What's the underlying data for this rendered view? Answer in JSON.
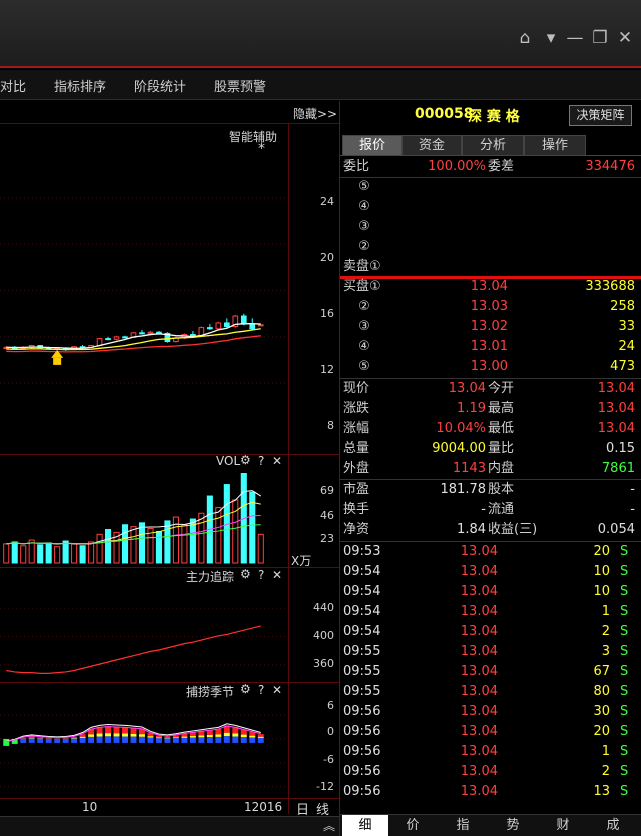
{
  "menu": [
    "对比",
    "指标排序",
    "阶段统计",
    "股票预警"
  ],
  "hide_label": "隐藏>>",
  "main_chart": {
    "title": "智能辅助",
    "star": "*",
    "y_ticks": [
      "24",
      "20",
      "16",
      "12",
      "8"
    ]
  },
  "vol_panel": {
    "title": "VOL",
    "y_ticks": [
      "69",
      "46",
      "23"
    ],
    "unit": "X万"
  },
  "zlzz_panel": {
    "title": "主力追踪",
    "y_ticks": [
      "440",
      "400",
      "360"
    ]
  },
  "bljj_panel": {
    "title": "捕捞季节",
    "y_ticks": [
      "6",
      "0",
      "-6",
      "-12"
    ]
  },
  "x_axis": {
    "labels": [
      "10",
      "12016"
    ],
    "period": "日",
    "line": "线"
  },
  "panel_icons": {
    "gear": "⚙",
    "help": "?",
    "close": "✕"
  },
  "stock": {
    "code": "000058",
    "name": "深 赛 格",
    "decision_btn": "决策矩阵"
  },
  "tabs": [
    "报价",
    "资金",
    "分析",
    "操作"
  ],
  "weibi": {
    "label": "委比",
    "value": "100.00%",
    "diff_label": "委差",
    "diff_value": "334476"
  },
  "sell_orders": [
    {
      "label": "⑤",
      "price": "",
      "vol": ""
    },
    {
      "label": "④",
      "price": "",
      "vol": ""
    },
    {
      "label": "③",
      "price": "",
      "vol": ""
    },
    {
      "label": "②",
      "price": "",
      "vol": ""
    },
    {
      "label": "卖盘①",
      "price": "",
      "vol": ""
    }
  ],
  "buy_orders": [
    {
      "label": "买盘①",
      "price": "13.04",
      "vol": "333688"
    },
    {
      "label": "②",
      "price": "13.03",
      "vol": "258"
    },
    {
      "label": "③",
      "price": "13.02",
      "vol": "33"
    },
    {
      "label": "④",
      "price": "13.01",
      "vol": "24"
    },
    {
      "label": "⑤",
      "price": "13.00",
      "vol": "473"
    }
  ],
  "stats1": [
    {
      "l1": "现价",
      "v1": "13.04",
      "l2": "今开",
      "v2": "13.04"
    },
    {
      "l1": "涨跌",
      "v1": "1.19",
      "l2": "最高",
      "v2": "13.04"
    },
    {
      "l1": "涨幅",
      "v1": "10.04%",
      "l2": "最低",
      "v2": "13.04"
    },
    {
      "l1": "总量",
      "v1": "9004.00",
      "l2": "量比",
      "v2": "0.15"
    },
    {
      "l1": "外盘",
      "v1": "1143",
      "l2": "内盘",
      "v2": "7861"
    }
  ],
  "stats2": [
    {
      "l1": "市盈",
      "v1": "181.78",
      "l2": "股本",
      "v2": "-"
    },
    {
      "l1": "换手",
      "v1": "-",
      "l2": "流通",
      "v2": "-"
    },
    {
      "l1": "净资",
      "v1": "1.84",
      "l2": "收益(三)",
      "v2": "0.054"
    }
  ],
  "ticks": [
    {
      "time": "09:53",
      "price": "13.04",
      "vol": "20",
      "flag": "S"
    },
    {
      "time": "09:54",
      "price": "13.04",
      "vol": "10",
      "flag": "S"
    },
    {
      "time": "09:54",
      "price": "13.04",
      "vol": "10",
      "flag": "S"
    },
    {
      "time": "09:54",
      "price": "13.04",
      "vol": "1",
      "flag": "S"
    },
    {
      "time": "09:54",
      "price": "13.04",
      "vol": "2",
      "flag": "S"
    },
    {
      "time": "09:55",
      "price": "13.04",
      "vol": "3",
      "flag": "S"
    },
    {
      "time": "09:55",
      "price": "13.04",
      "vol": "67",
      "flag": "S"
    },
    {
      "time": "09:55",
      "price": "13.04",
      "vol": "80",
      "flag": "S"
    },
    {
      "time": "09:56",
      "price": "13.04",
      "vol": "30",
      "flag": "S"
    },
    {
      "time": "09:56",
      "price": "13.04",
      "vol": "20",
      "flag": "S"
    },
    {
      "time": "09:56",
      "price": "13.04",
      "vol": "1",
      "flag": "S"
    },
    {
      "time": "09:56",
      "price": "13.04",
      "vol": "2",
      "flag": "S"
    },
    {
      "time": "09:56",
      "price": "13.04",
      "vol": "13",
      "flag": "S"
    }
  ],
  "bottom_tabs": [
    "细",
    "价",
    "指",
    "势",
    "财",
    "成"
  ],
  "colors": {
    "up": "#ff4040",
    "down": "#40ffff",
    "accent_red": "#e01010",
    "yellow": "#ffff30"
  },
  "chart_data": [
    {
      "type": "line",
      "panel": "智能辅助",
      "ylim": [
        8,
        24
      ],
      "candles": [
        [
          11.0,
          11.2,
          10.9,
          11.1
        ],
        [
          11.1,
          11.2,
          10.95,
          11.05
        ],
        [
          11.05,
          11.2,
          11.0,
          11.1
        ],
        [
          11.1,
          11.3,
          11.0,
          11.25
        ],
        [
          11.25,
          11.3,
          11.0,
          11.05
        ],
        [
          11.05,
          11.15,
          10.9,
          10.95
        ],
        [
          10.95,
          11.1,
          10.85,
          11.0
        ],
        [
          11.0,
          11.1,
          10.8,
          10.9
        ],
        [
          10.9,
          11.2,
          10.85,
          11.15
        ],
        [
          11.15,
          11.3,
          11.0,
          11.1
        ],
        [
          11.1,
          11.3,
          11.05,
          11.25
        ],
        [
          11.25,
          11.9,
          11.2,
          11.85
        ],
        [
          11.85,
          12.0,
          11.7,
          11.8
        ],
        [
          11.8,
          12.1,
          11.7,
          12.0
        ],
        [
          12.0,
          12.1,
          11.85,
          11.95
        ],
        [
          11.95,
          12.4,
          11.9,
          12.35
        ],
        [
          12.35,
          12.6,
          12.2,
          12.3
        ],
        [
          12.3,
          12.5,
          12.15,
          12.4
        ],
        [
          12.4,
          12.5,
          12.2,
          12.3
        ],
        [
          12.3,
          12.4,
          11.5,
          11.6
        ],
        [
          11.6,
          12.0,
          11.5,
          11.9
        ],
        [
          11.9,
          12.3,
          11.8,
          12.2
        ],
        [
          12.2,
          12.5,
          12.0,
          12.1
        ],
        [
          12.1,
          12.9,
          12.0,
          12.8
        ],
        [
          12.8,
          13.1,
          12.6,
          12.7
        ],
        [
          12.7,
          13.3,
          12.6,
          13.2
        ],
        [
          13.2,
          13.6,
          12.8,
          12.9
        ],
        [
          12.9,
          13.9,
          12.8,
          13.8
        ],
        [
          13.8,
          14.0,
          13.0,
          13.1
        ],
        [
          13.1,
          13.6,
          12.6,
          12.7
        ],
        [
          13.04,
          13.04,
          13.04,
          13.04
        ]
      ]
    },
    {
      "type": "bar",
      "panel": "VOL",
      "ylim": [
        0,
        92
      ],
      "values": [
        20,
        22,
        18,
        24,
        19,
        21,
        17,
        23,
        20,
        18,
        22,
        30,
        35,
        32,
        40,
        38,
        42,
        36,
        33,
        44,
        48,
        40,
        46,
        52,
        70,
        58,
        82,
        66,
        98,
        74,
        30
      ]
    },
    {
      "type": "line",
      "panel": "主力追踪",
      "ylim": [
        340,
        470
      ],
      "values": [
        352,
        350,
        349,
        349,
        348,
        348,
        349,
        350,
        352,
        355,
        358,
        361,
        364,
        367,
        370,
        373,
        376,
        379,
        381,
        384,
        387,
        390,
        392,
        395,
        398,
        401,
        403,
        406,
        409,
        412,
        415
      ]
    },
    {
      "type": "bar",
      "panel": "捕捞季节",
      "ylim": [
        -12,
        8
      ],
      "values": [
        -1,
        -0.5,
        0.3,
        0.6,
        0.4,
        0.2,
        0.1,
        0.2,
        0.5,
        1.2,
        2.5,
        3.0,
        3.2,
        3.1,
        3.0,
        2.8,
        2.6,
        1.5,
        0.8,
        0.6,
        0.9,
        1.3,
        1.6,
        1.9,
        2.2,
        2.5,
        3.4,
        3.0,
        2.4,
        1.8,
        1.2
      ]
    }
  ]
}
